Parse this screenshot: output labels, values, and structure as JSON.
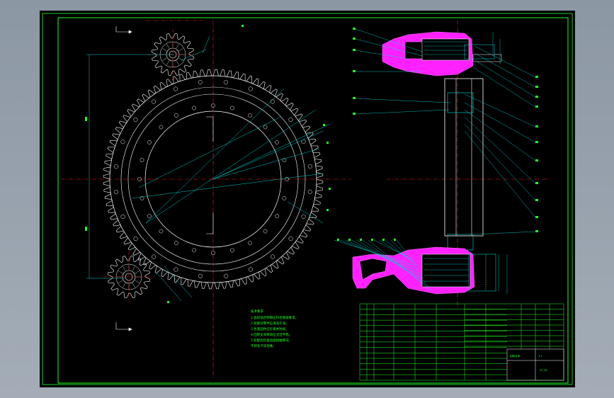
{
  "drawing": {
    "colors": {
      "frame": "#22ff22",
      "geometry": "#ffffff",
      "dimension": "#00cccc",
      "center_line": "#ff2222",
      "section_fill": "#ff22ff",
      "hatch": "#00e0e0",
      "hidden": "#ffff00"
    },
    "slewing_ring": {
      "outer_teeth": 96,
      "bolt_holes_outer": 24,
      "bolt_holes_inner": 24
    },
    "pinions": [
      {
        "teeth": 16
      },
      {
        "teeth": 16
      }
    ],
    "technical_requirements": {
      "heading": "技术要求",
      "lines": [
        "1.齿轮啮合侧隙应符合图纸要求。",
        "2.装配前零件应清洗干净。",
        "3.各紧固件应拧紧并防松。",
        "4.回转支承转动应灵活平稳。",
        "5.装配后检查齿面接触情况,",
        "不得有卡滞现象。"
      ]
    },
    "title_block": {
      "title": "回转支承",
      "scale": "1:1",
      "drawing_no": "ZC-00"
    }
  }
}
